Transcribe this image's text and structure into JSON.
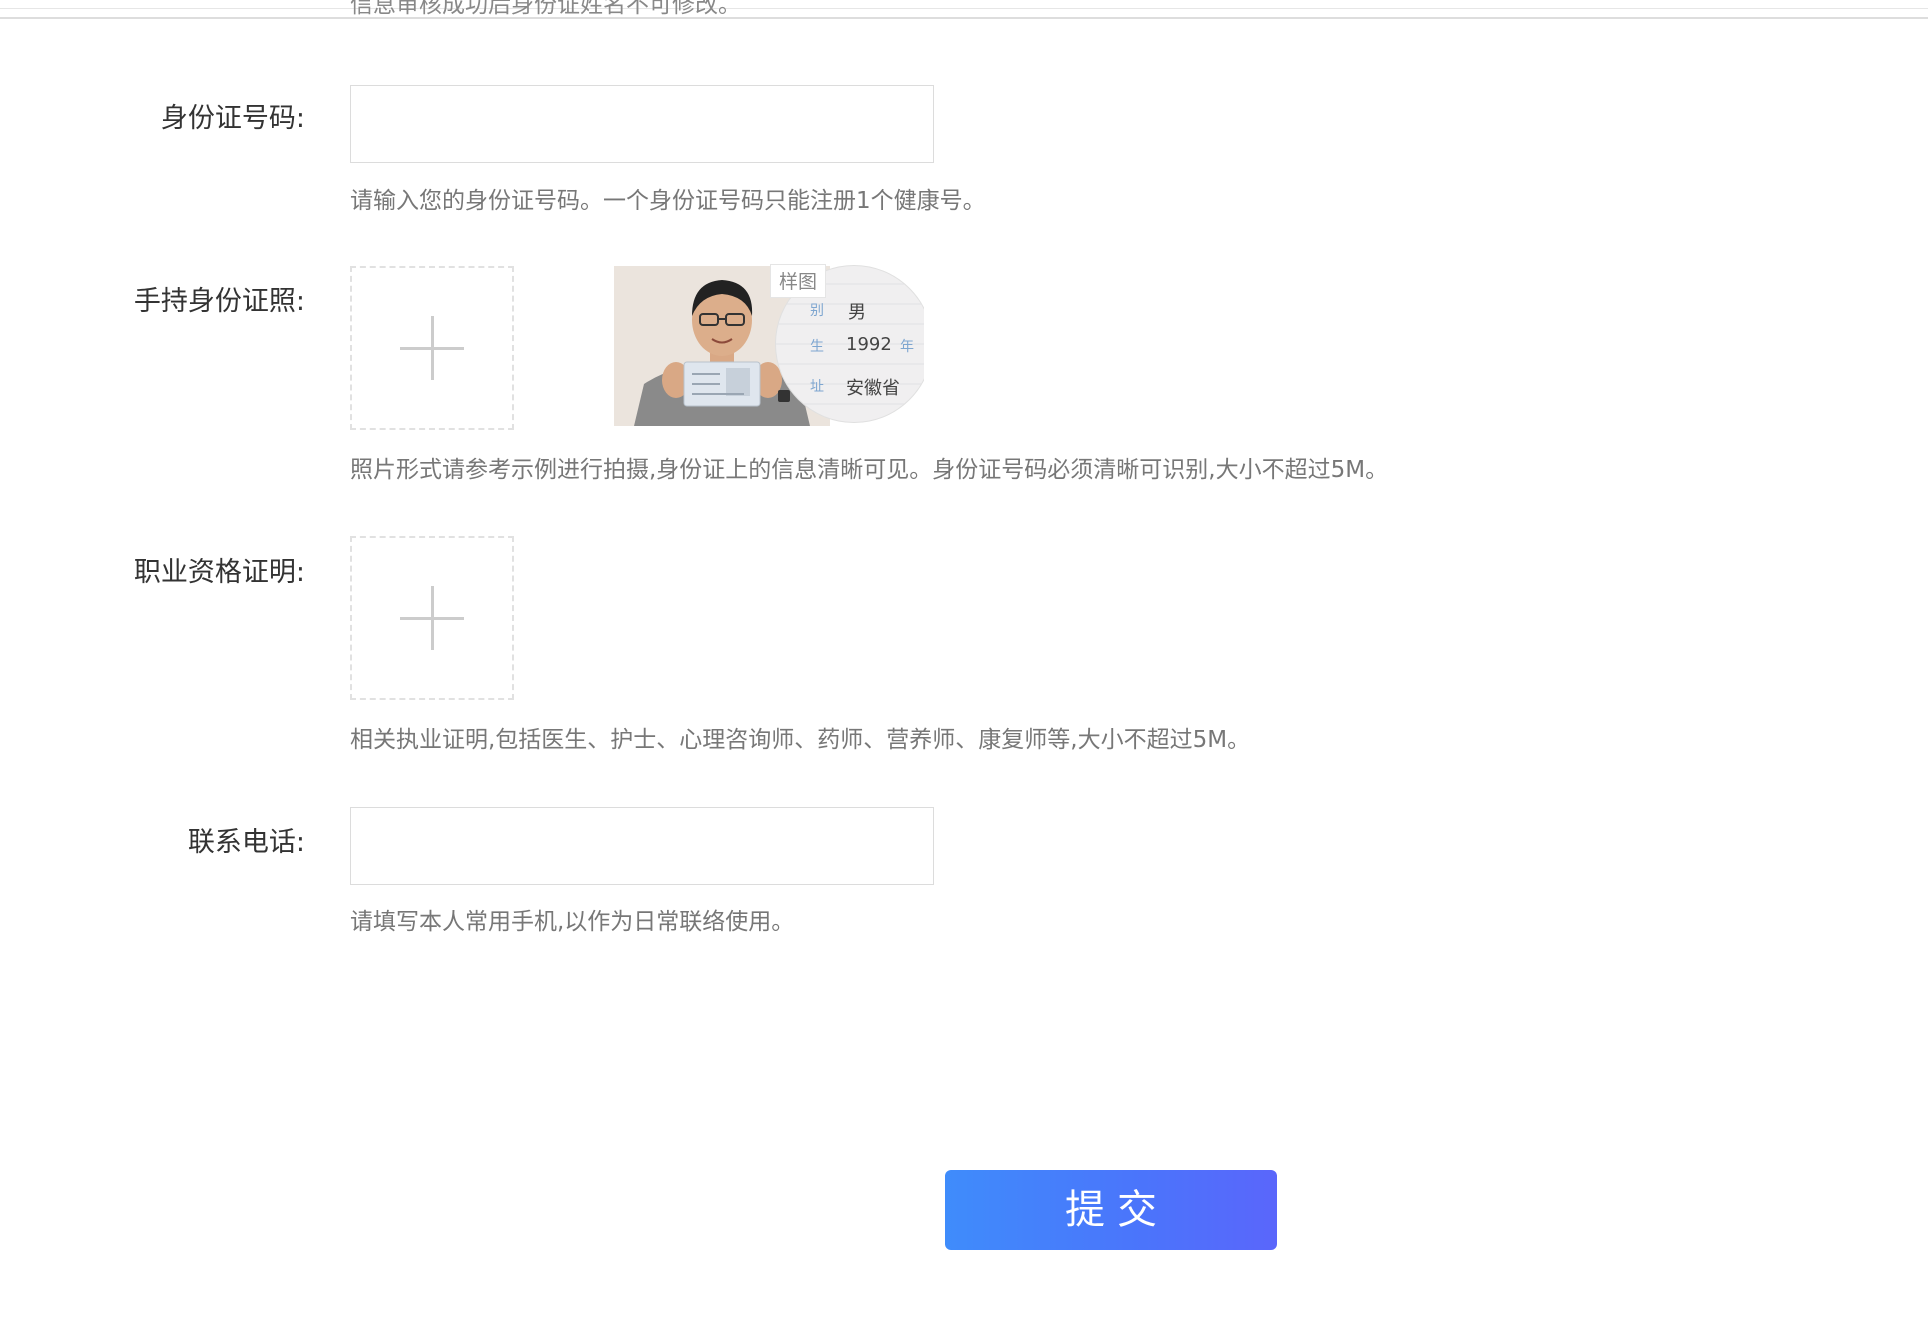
{
  "top_cut_text": "信息审核成功后身份证姓名不可修改。",
  "fields": {
    "id_number": {
      "label": "身份证号码:",
      "value": "",
      "placeholder": "",
      "hint": "请输入您的身份证号码。一个身份证号码只能注册1个健康号。"
    },
    "id_photo": {
      "label": "手持身份证照:",
      "hint": "照片形式请参考示例进行拍摄,身份证上的信息清晰可见。身份证号码必须清晰可识别,大小不超过5M。",
      "sample": {
        "tag": "样图",
        "lines": [
          "男",
          "1992",
          "安徽省"
        ],
        "side_chars": [
          "别",
          "生",
          "年",
          "址"
        ]
      }
    },
    "qualification": {
      "label": "职业资格证明:",
      "hint": "相关执业证明,包括医生、护士、心理咨询师、药师、营养师、康复师等,大小不超过5M。"
    },
    "phone": {
      "label": "联系电话:",
      "value": "",
      "placeholder": "",
      "hint": "请填写本人常用手机,以作为日常联络使用。"
    }
  },
  "submit_label": "提交",
  "colors": {
    "accent_start": "#3f8cfb",
    "accent_end": "#5a66fb",
    "hint_text": "#777777",
    "label_text": "#333333",
    "border": "#dcdcdc"
  },
  "icons": {
    "upload": "plus-icon"
  }
}
